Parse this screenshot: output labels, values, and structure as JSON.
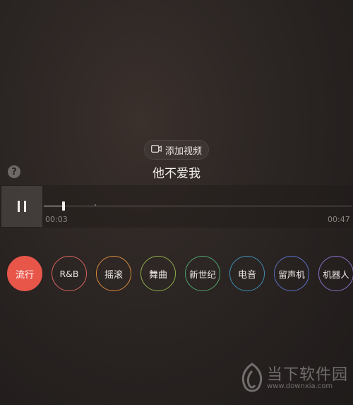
{
  "player": {
    "add_video_label": "添加视频",
    "song_title": "他不爱我",
    "current_time": "00:03",
    "total_time": "00:47",
    "progress_fraction": 0.064,
    "is_playing": true
  },
  "help": {
    "label": "?"
  },
  "genres": [
    {
      "label": "流行",
      "color": "#e8564a",
      "active": true
    },
    {
      "label": "R&B",
      "color": "#d9655c",
      "active": false
    },
    {
      "label": "摇滚",
      "color": "#d98a3c",
      "active": false
    },
    {
      "label": "舞曲",
      "color": "#8fae4a",
      "active": false
    },
    {
      "label": "新世纪",
      "color": "#4fa36b",
      "active": false
    },
    {
      "label": "电音",
      "color": "#3f8fb3",
      "active": false
    },
    {
      "label": "留声机",
      "color": "#5b6fc4",
      "active": false
    },
    {
      "label": "机器人",
      "color": "#8a6fc4",
      "active": false
    }
  ],
  "watermark": {
    "title": "当下软件园",
    "url": "www.downxia.com"
  }
}
